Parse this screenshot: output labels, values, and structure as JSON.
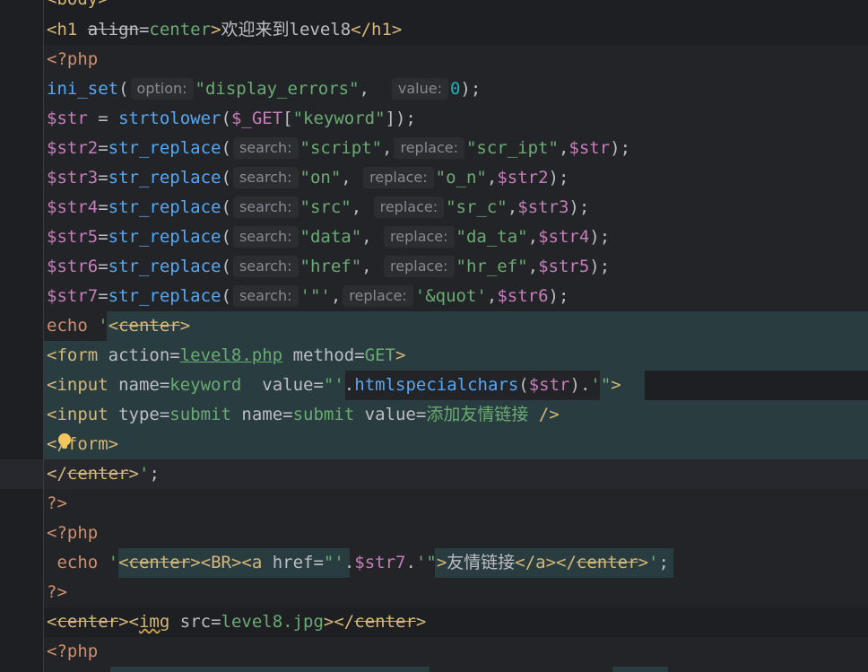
{
  "editor": {
    "lines": [
      {
        "text": "<body>"
      },
      {
        "text": "<h1 align=center>欢迎来到level8</h1>"
      },
      {
        "text": "<?php"
      },
      {
        "text": "ini_set( option: \"display_errors\",  value: 0);"
      },
      {
        "text": "$str = strtolower($_GET[\"keyword\"]);"
      },
      {
        "text": "$str2=str_replace( search: \"script\", replace: \"scr_ipt\",$str);"
      },
      {
        "text": "$str3=str_replace( search: \"on\", replace: \"o_n\",$str2);"
      },
      {
        "text": "$str4=str_replace( search: \"src\", replace: \"sr_c\",$str3);"
      },
      {
        "text": "$str5=str_replace( search: \"data\", replace: \"da_ta\",$str4);"
      },
      {
        "text": "$str6=str_replace( search: \"href\", replace: \"hr_ef\",$str5);"
      },
      {
        "text": "$str7=str_replace( search: '\"', replace: '&quot',$str6);"
      },
      {
        "text": "echo '<center>"
      },
      {
        "text": "<form action=level8.php method=GET>"
      },
      {
        "text": "<input name=keyword  value=\"'.htmlspecialchars($str).'\">"
      },
      {
        "text": "<input type=submit name=submit value=添加友情链接 />"
      },
      {
        "text": "</form>"
      },
      {
        "text": "</center>';"
      },
      {
        "text": "?>"
      },
      {
        "text": "<?php"
      },
      {
        "text": " echo '<center><BR><a href=\"'.$str7.'\">友情链接</a></center>';"
      },
      {
        "text": "?>"
      },
      {
        "text": "<center><img src=level8.jpg></center>"
      },
      {
        "text": "<?php"
      }
    ],
    "hints": {
      "option": "option:",
      "value": "value:",
      "search": "search:",
      "replace": "replace:"
    },
    "colors": {
      "background": "#1e1f22",
      "tag": "#d5b778",
      "string": "#6aab73",
      "keyword": "#cf8e6d",
      "function": "#56a8f5",
      "variable": "#c77dbb",
      "number": "#2aacb8",
      "embedded_html_bg": "#293c3f"
    }
  }
}
